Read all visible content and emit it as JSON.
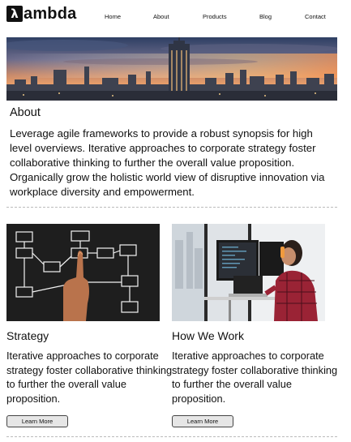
{
  "brand": {
    "logo_glyph": "λ",
    "name": "ambda"
  },
  "nav": {
    "items": [
      {
        "label": "Home"
      },
      {
        "label": "About"
      },
      {
        "label": "Products"
      },
      {
        "label": "Blog"
      },
      {
        "label": "Contact"
      }
    ]
  },
  "about": {
    "title": "About",
    "text": "Leverage agile frameworks to provide a robust synopsis for high level overviews. Iterative approaches to corporate strategy foster collaborative thinking to further the overall value proposition. Organically grow the holistic world view of disruptive innovation via workplace diversity and empowerment."
  },
  "cards": [
    {
      "title": "Strategy",
      "text": "Iterative approaches to corporate strategy foster collaborative thinking to further the overall value proposition.",
      "button": "Learn More"
    },
    {
      "title": "How We Work",
      "text": "Iterative approaches to corporate strategy foster collaborative thinking to further the overall value proposition.",
      "button": "Learn More"
    }
  ]
}
